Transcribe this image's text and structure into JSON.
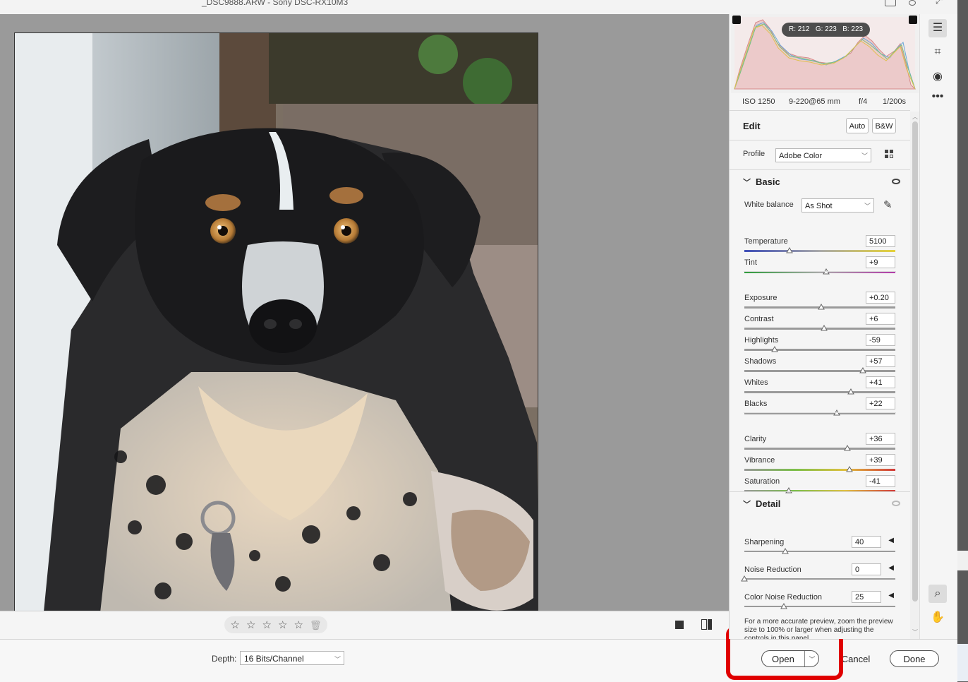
{
  "window": {
    "filename": "_DSC9888.ARW  -  Sony DSC-RX10M3"
  },
  "histogram": {
    "readout": {
      "r": "R: 212",
      "g": "G: 223",
      "b": "B: 223"
    }
  },
  "exif": {
    "iso": "ISO 1250",
    "lens": "9-220@65 mm",
    "aperture": "f/4",
    "shutter": "1/200s"
  },
  "edit": {
    "title": "Edit",
    "auto_label": "Auto",
    "bw_label": "B&W",
    "profile_label": "Profile",
    "profile_value": "Adobe Color"
  },
  "basic": {
    "title": "Basic",
    "wb_label": "White balance",
    "wb_value": "As Shot",
    "sliders": [
      {
        "name": "Temperature",
        "value": "5100",
        "pos": 0.3,
        "gradient": "temp"
      },
      {
        "name": "Tint",
        "value": "+9",
        "pos": 0.54,
        "gradient": "tint"
      },
      {
        "name": "Exposure",
        "value": "+0.20",
        "pos": 0.51,
        "gradient": ""
      },
      {
        "name": "Contrast",
        "value": "+6",
        "pos": 0.53,
        "gradient": ""
      },
      {
        "name": "Highlights",
        "value": "-59",
        "pos": 0.2,
        "gradient": ""
      },
      {
        "name": "Shadows",
        "value": "+57",
        "pos": 0.785,
        "gradient": ""
      },
      {
        "name": "Whites",
        "value": "+41",
        "pos": 0.705,
        "gradient": ""
      },
      {
        "name": "Blacks",
        "value": "+22",
        "pos": 0.61,
        "gradient": ""
      },
      {
        "name": "Clarity",
        "value": "+36",
        "pos": 0.68,
        "gradient": ""
      },
      {
        "name": "Vibrance",
        "value": "+39",
        "pos": 0.695,
        "gradient": "vib"
      },
      {
        "name": "Saturation",
        "value": "-41",
        "pos": 0.295,
        "gradient": "sat"
      }
    ]
  },
  "detail": {
    "title": "Detail",
    "sliders": [
      {
        "name": "Sharpening",
        "value": "40",
        "pos": 0.27
      },
      {
        "name": "Noise Reduction",
        "value": "0",
        "pos": 0.0
      },
      {
        "name": "Color Noise Reduction",
        "value": "25",
        "pos": 0.26
      }
    ],
    "note": "For a more accurate preview, zoom the preview size to 100% or larger when adjusting the controls in this panel."
  },
  "bottom": {
    "depth_label": "Depth:",
    "depth_value": "16 Bits/Channel",
    "open_label": "Open",
    "cancel_label": "Cancel",
    "done_label": "Done"
  },
  "colors": {
    "highlight": "#e00000",
    "panel": "#f5f5f5",
    "canvas": "#9a9a9a"
  }
}
